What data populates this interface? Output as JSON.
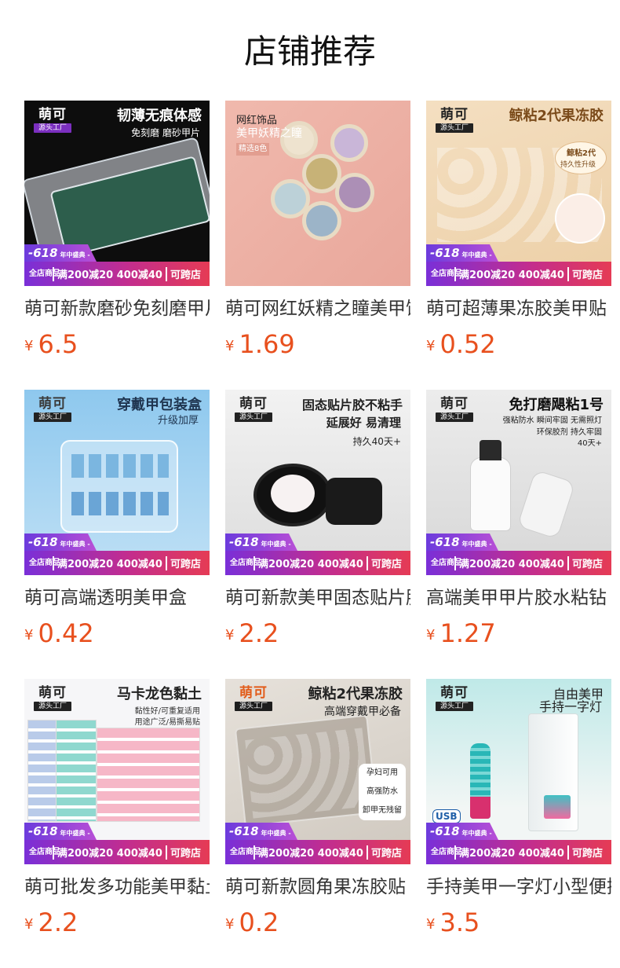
{
  "page_title": "店铺推荐",
  "currency": "¥",
  "promo": {
    "badge_618": "-618",
    "badge_sub": "年中盛典 -",
    "all_store": "全店商品",
    "deal": "满200减20 400减40",
    "cross_store": "可跨店"
  },
  "brand": {
    "name": "萌可",
    "sub": "源头工厂"
  },
  "colors": {
    "price": "#e8501e",
    "promo_start": "#7a2fd8",
    "promo_end": "#e53b55"
  },
  "products": [
    {
      "title": "萌可新款磨砂免刻磨甲片",
      "price": "6.5",
      "thumb": {
        "headline": "韧薄无痕体感",
        "sub1": "免刻磨 磨砂甲片",
        "sub2": ""
      }
    },
    {
      "title": "萌可网红妖精之瞳美甲饰品",
      "price": "1.69",
      "thumb": {
        "headline": "网红饰品",
        "sub1": "美甲妖精之瞳",
        "sub2": "精选8色"
      }
    },
    {
      "title": "萌可超薄果冻胶美甲贴",
      "price": "0.52",
      "thumb": {
        "headline": "鲸粘2代果冻胶",
        "sub1": "鲸粘2代",
        "sub2": "持久性升级"
      }
    },
    {
      "title": "萌可高端透明美甲盒",
      "price": "0.42",
      "thumb": {
        "headline": "穿戴甲包装盒",
        "sub1": "升级加厚",
        "sub2": ""
      }
    },
    {
      "title": "萌可新款美甲固态贴片胶",
      "price": "2.2",
      "thumb": {
        "headline": "固态贴片胶不粘手",
        "sub1": "延展好 易清理",
        "sub2": "持久40天+"
      }
    },
    {
      "title": "高端美甲甲片胶水粘钻",
      "price": "1.27",
      "thumb": {
        "headline": "免打磨飓粘1号",
        "sub1": "强粘防水 瞬间牢固 无需照灯",
        "sub2": "环保胶剂 持久牢固40天+"
      }
    },
    {
      "title": "萌可批发多功能美甲黏土",
      "price": "2.2",
      "thumb": {
        "headline": "马卡龙色黏土",
        "sub1": "黏性好/可重复适用",
        "sub2": "用途广泛/易撕易贴"
      }
    },
    {
      "title": "萌可新款圆角果冻胶贴",
      "price": "0.2",
      "thumb": {
        "headline": "鲸粘2代果冻胶",
        "sub1": "高端穿戴甲必备",
        "sub2": "孕妇可用 高强防水 卸甲无残留"
      }
    },
    {
      "title": "手持美甲一字灯小型便携",
      "price": "3.5",
      "thumb": {
        "headline": "自由美甲",
        "sub1": "手持一字灯",
        "sub2": "USB"
      }
    }
  ]
}
